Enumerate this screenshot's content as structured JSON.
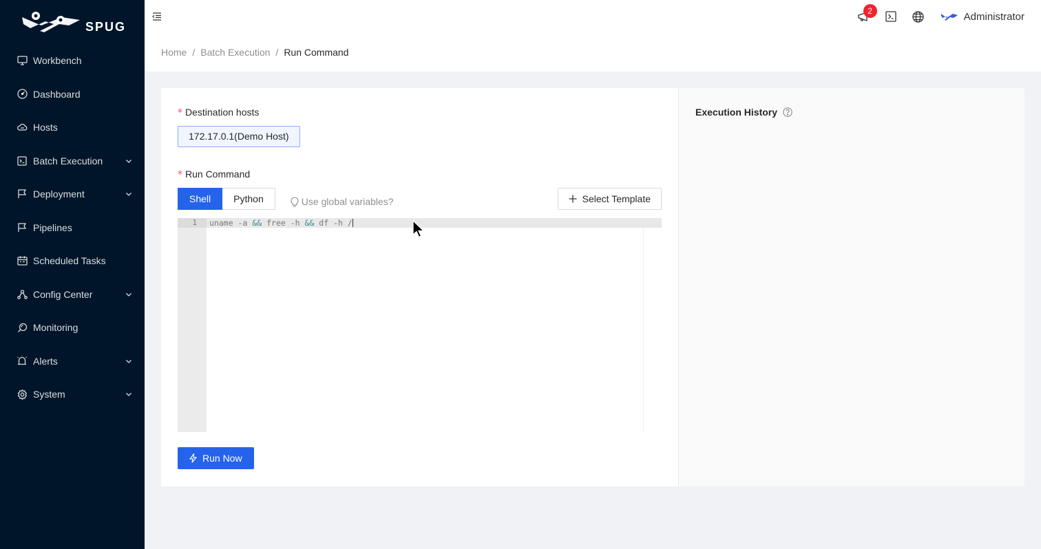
{
  "sidebar": {
    "logo_text": "SPUG",
    "items": [
      {
        "label": "Workbench",
        "icon": "desktop-icon",
        "has_arrow": false
      },
      {
        "label": "Dashboard",
        "icon": "dashboard-icon",
        "has_arrow": false
      },
      {
        "label": "Hosts",
        "icon": "cloud-server-icon",
        "has_arrow": false
      },
      {
        "label": "Batch Execution",
        "icon": "code-icon",
        "has_arrow": true
      },
      {
        "label": "Deployment",
        "icon": "flag-icon",
        "has_arrow": true
      },
      {
        "label": "Pipelines",
        "icon": "flag-icon",
        "has_arrow": false
      },
      {
        "label": "Scheduled Tasks",
        "icon": "schedule-icon",
        "has_arrow": false
      },
      {
        "label": "Config Center",
        "icon": "deployment-unit-icon",
        "has_arrow": true
      },
      {
        "label": "Monitoring",
        "icon": "monitor-icon",
        "has_arrow": false
      },
      {
        "label": "Alerts",
        "icon": "alert-icon",
        "has_arrow": true
      },
      {
        "label": "System",
        "icon": "setting-icon",
        "has_arrow": true
      }
    ]
  },
  "header": {
    "notification_count": "2",
    "user_name": "Administrator"
  },
  "breadcrumb": {
    "items": [
      "Home",
      "Batch Execution",
      "Run Command"
    ]
  },
  "form": {
    "hosts_label": "Destination hosts",
    "host_value": "172.17.0.1(Demo Host)",
    "command_label": "Run Command",
    "tabs": [
      "Shell",
      "Python"
    ],
    "active_tab": "Shell",
    "global_vars_link": "Use global variables?",
    "template_button": "Select Template",
    "editor": {
      "line_number": "1",
      "code_parts": [
        "uname -a ",
        "&&",
        " free -h ",
        "&&",
        " df -h /"
      ]
    },
    "run_button": "Run Now"
  },
  "history": {
    "title": "Execution History"
  },
  "colors": {
    "primary": "#2563eb",
    "sidebar_bg": "#001529",
    "required": "#ff4d4f",
    "badge": "#f5222d"
  }
}
